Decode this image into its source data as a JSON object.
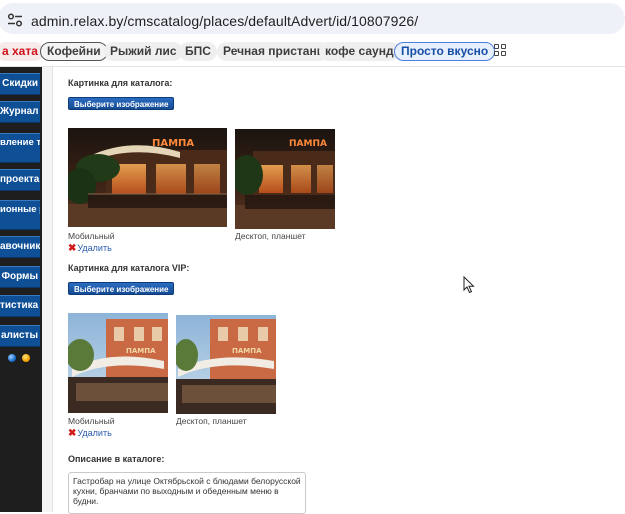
{
  "browser": {
    "url": "admin.relax.by/cmscatalog/places/defaultAdvert/id/10807926/",
    "site_info_icon": "tune-icon"
  },
  "bookmarks": [
    {
      "label": "а хата",
      "style": "red"
    },
    {
      "label": "Кофейни",
      "style": "outlined"
    },
    {
      "label": "Рыжий лис",
      "style": "plain"
    },
    {
      "label": "БПС",
      "style": "plain"
    },
    {
      "label": "Речная пристань",
      "style": "plain"
    },
    {
      "label": "кофе саунд",
      "style": "plain"
    },
    {
      "label": "Просто вкусно",
      "style": "blue"
    }
  ],
  "bookmarks_apps_icon": "apps-grid-icon",
  "sidebar": {
    "items": [
      {
        "label": "Скидки"
      },
      {
        "label": "Журнал"
      },
      {
        "label": "вление\nтелями"
      },
      {
        "label": "проекта"
      },
      {
        "label": "ионные\nраницы"
      },
      {
        "label": "авочник"
      },
      {
        "label": "Формы"
      },
      {
        "label": "тистика"
      },
      {
        "label": "алисты"
      }
    ],
    "icons": [
      "globe-icon",
      "smile-icon"
    ]
  },
  "catalog_image": {
    "label": "Картинка для каталога:",
    "button": "Выберите изображение",
    "captions": [
      "Мобильный",
      "Десктоп, планшет"
    ],
    "delete": "Удалить",
    "sign_text": "ПАМПА"
  },
  "vip_image": {
    "label": "Картинка для каталога VIP:",
    "button": "Выберите изображение",
    "captions": [
      "Мобильный",
      "Десктоп, планшет"
    ],
    "delete": "Удалить",
    "sign_text": "ПАМПА"
  },
  "description": {
    "label": "Описание в каталоге:",
    "text": "Гастробар на улице Октябрьской с блюдами белорусской кухни, бранчами по выходным и обеденным меню в будни."
  },
  "colors": {
    "sidebar_blue": "#0f4f96",
    "button_blue": "#154a93",
    "link_blue": "#2a5db0",
    "delete_red": "#d21c1c"
  }
}
